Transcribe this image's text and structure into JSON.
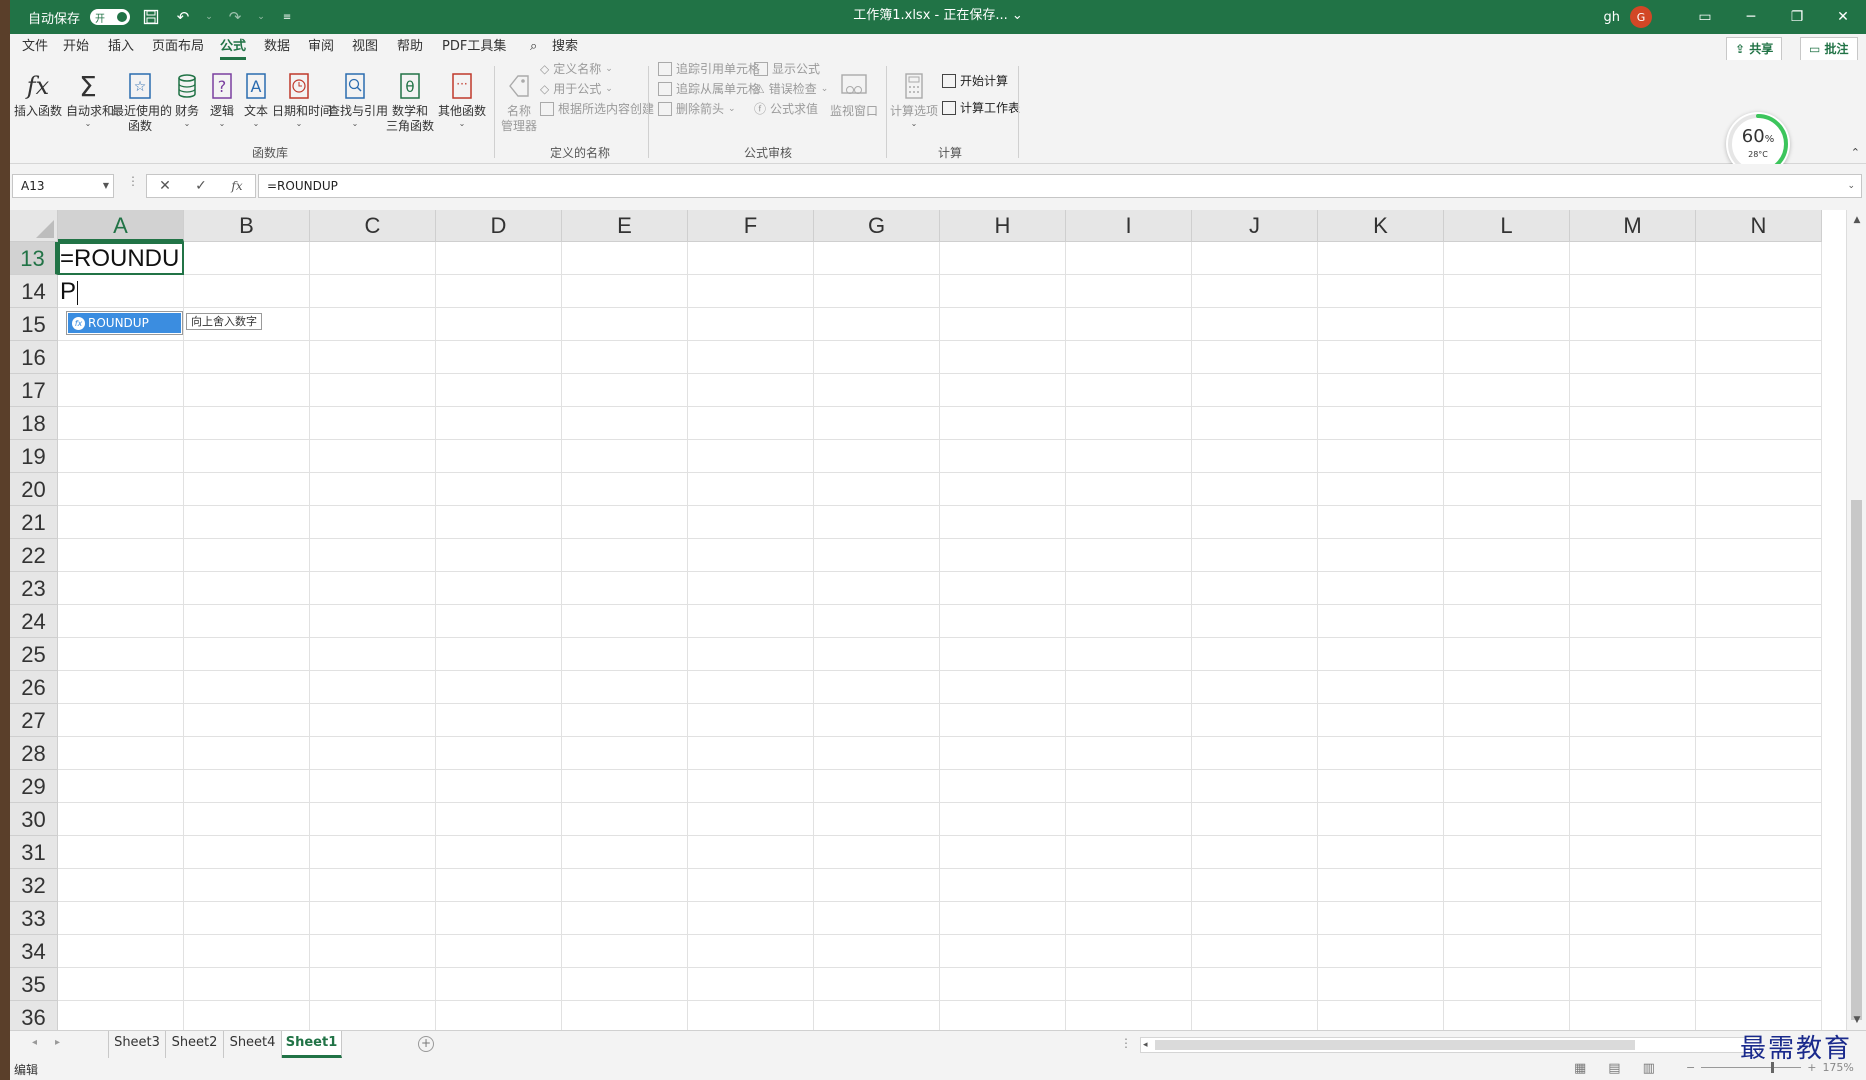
{
  "titlebar": {
    "autosave_label": "自动保存",
    "autosave_state": "开",
    "window_title": "工作簿1.xlsx - 正在保存... ⌄",
    "user": "gh",
    "avatar_initial": "G"
  },
  "menu": {
    "tabs": [
      "文件",
      "开始",
      "插入",
      "页面布局",
      "公式",
      "数据",
      "审阅",
      "视图",
      "帮助",
      "PDF工具集"
    ],
    "active_tab": "公式",
    "search": "搜索",
    "share": "共享",
    "comment": "批注"
  },
  "ribbon": {
    "function_library": {
      "insert_function": "插入函数",
      "autosum": "自动求和",
      "recent_line1": "最近使用的",
      "recent_line2": "函数",
      "financial": "财务",
      "logical": "逻辑",
      "text": "文本",
      "datetime": "日期和时间",
      "lookup": "查找与引用",
      "math_line1": "数学和",
      "math_line2": "三角函数",
      "more": "其他函数",
      "group_label": "函数库"
    },
    "defined_names": {
      "name_manager_line1": "名称",
      "name_manager_line2": "管理器",
      "define_name": "定义名称",
      "use_in_formula": "用于公式",
      "create_from_selection": "根据所选内容创建",
      "group_label": "定义的名称"
    },
    "formula_auditing": {
      "trace_precedents": "追踪引用单元格",
      "trace_dependents": "追踪从属单元格",
      "remove_arrows": "删除箭头",
      "show_formulas": "显示公式",
      "error_checking": "错误检查",
      "evaluate_formula": "公式求值",
      "watch_window": "监视窗口",
      "group_label": "公式审核"
    },
    "calculation": {
      "calc_options": "计算选项",
      "calc_now": "开始计算",
      "calc_sheet": "计算工作表",
      "group_label": "计算"
    }
  },
  "gauge": {
    "percent": "60",
    "unit": "%",
    "temperature": "28°C"
  },
  "formula_bar": {
    "name_box": "A13",
    "cancel": "✕",
    "enter": "✓",
    "fx": "fx",
    "formula": "=ROUNDUP"
  },
  "grid": {
    "columns": [
      "A",
      "B",
      "C",
      "D",
      "E",
      "F",
      "G",
      "H",
      "I",
      "J",
      "K",
      "L",
      "M",
      "N"
    ],
    "rows": [
      "13",
      "14",
      "15",
      "16",
      "17",
      "18",
      "19",
      "20",
      "21",
      "22",
      "23",
      "24",
      "25",
      "26",
      "27",
      "28",
      "29",
      "30",
      "31",
      "32",
      "33",
      "34",
      "35",
      "36"
    ],
    "active_cell": "A13",
    "edit_text_line1": "=ROUNDU",
    "edit_text_line2": "P"
  },
  "autocomplete": {
    "item": "ROUNDUP",
    "tooltip": "向上舍入数字"
  },
  "sheets": {
    "tabs": [
      "Sheet3",
      "Sheet2",
      "Sheet4",
      "Sheet1"
    ],
    "active": "Sheet1"
  },
  "status": {
    "mode": "编辑",
    "zoom": "175%"
  },
  "watermark": "最需教育",
  "colors": {
    "brand": "#217346",
    "autocomplete_highlight": "#3b8de0"
  }
}
